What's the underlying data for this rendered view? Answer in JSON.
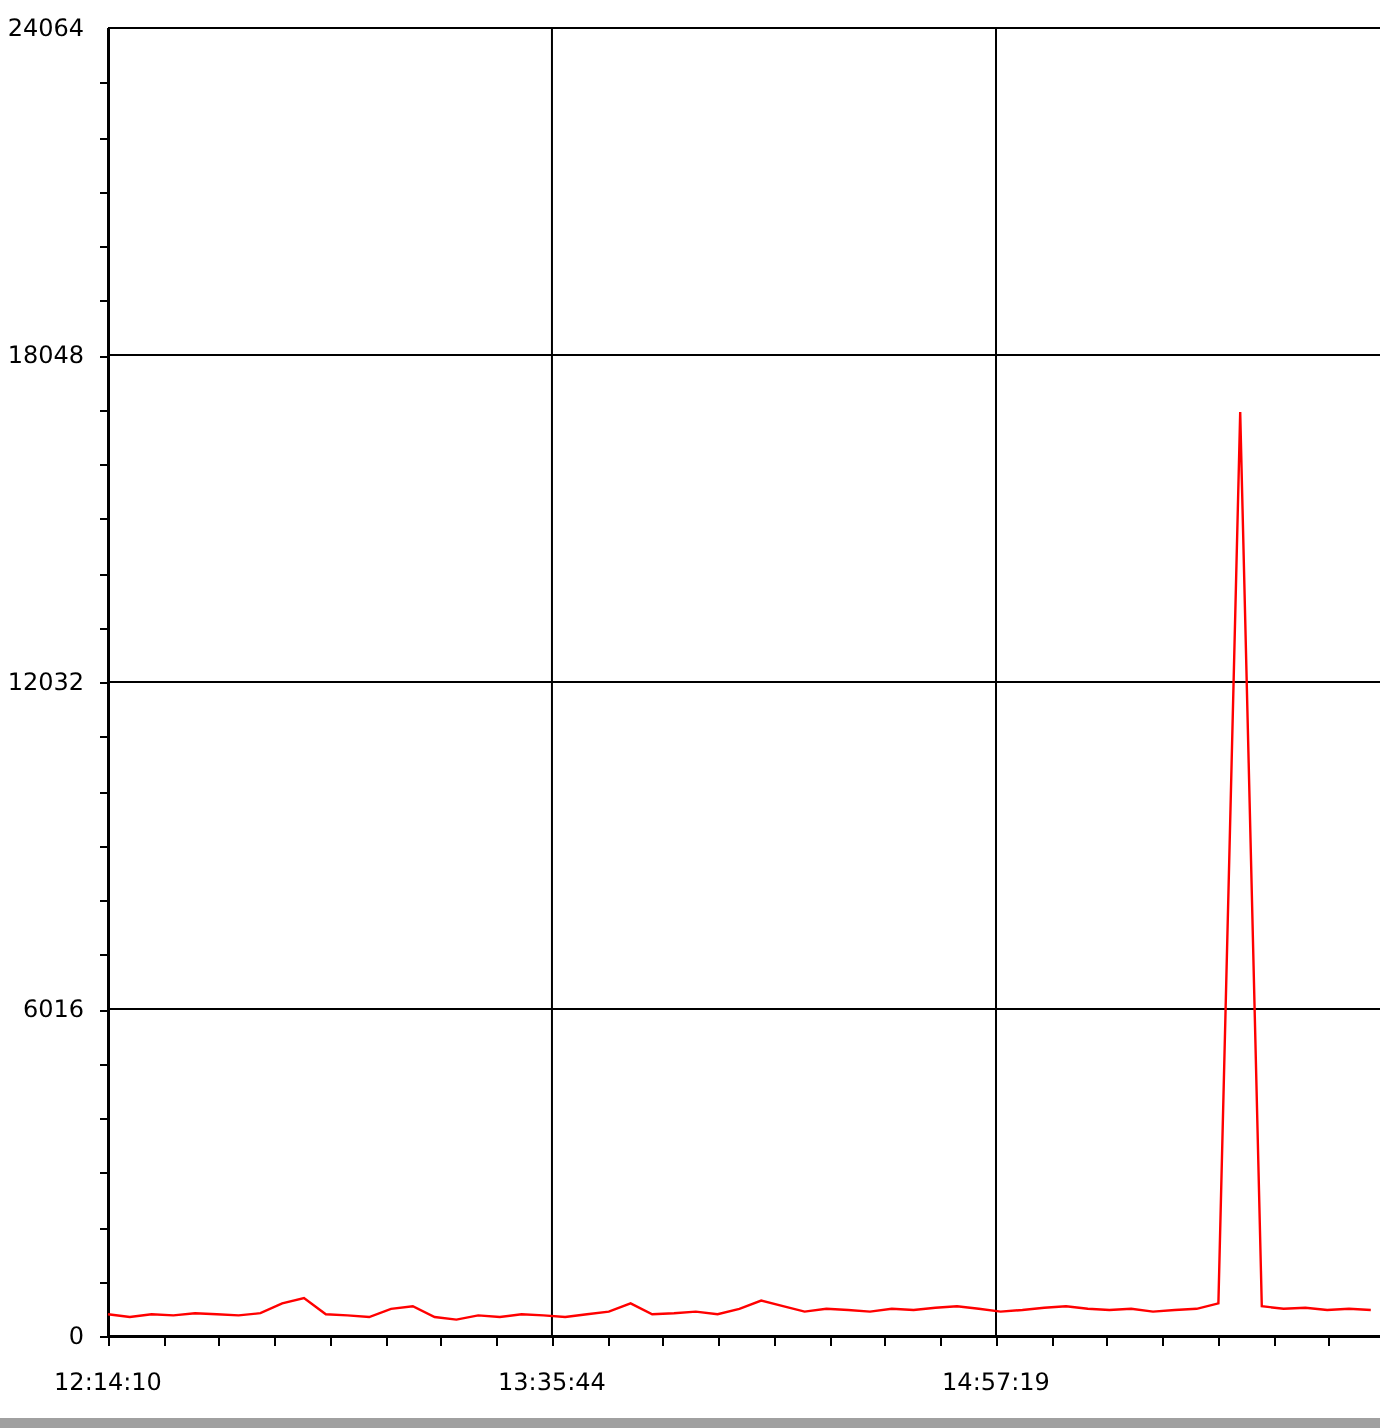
{
  "chart": {
    "chart_data": {
      "type": "line",
      "grid": true,
      "x": [
        44050,
        44290,
        44530,
        44770,
        45010,
        45250,
        45490,
        45730,
        45970,
        46210,
        46450,
        46690,
        46930,
        47170,
        47410,
        47650,
        47890,
        48130,
        48370,
        48610,
        48850,
        49090,
        49330,
        49570,
        49810,
        50050,
        50290,
        50530,
        50770,
        51010,
        51250,
        51490,
        51730,
        51970,
        52210,
        52450,
        52690,
        52930,
        53170,
        53410,
        53650,
        53890,
        54130,
        54370,
        54610,
        54850,
        55090,
        55330,
        55570,
        55810,
        56050,
        56290,
        56530,
        56770,
        57010,
        57250,
        57490,
        57730,
        57970
      ],
      "series": [
        {
          "color": "#ff0000",
          "values": [
            400,
            350,
            400,
            380,
            420,
            400,
            380,
            420,
            600,
            700,
            400,
            380,
            350,
            500,
            550,
            350,
            300,
            380,
            350,
            400,
            380,
            350,
            400,
            450,
            600,
            400,
            420,
            450,
            400,
            500,
            650,
            550,
            450,
            500,
            480,
            450,
            500,
            480,
            520,
            550,
            500,
            450,
            480,
            520,
            550,
            500,
            480,
            500,
            450,
            480,
            500,
            600,
            17000,
            550,
            500,
            520,
            480,
            500,
            480
          ]
        }
      ],
      "xlim": [
        44050,
        58072
      ],
      "ylim": [
        0,
        24064
      ],
      "xticks": [
        {
          "value": 44050,
          "label": "12:14:10"
        },
        {
          "value": 48944,
          "label": "13:35:44"
        },
        {
          "value": 53839,
          "label": "14:57:19"
        }
      ],
      "yticks": [
        0,
        6016,
        12032,
        18048,
        24064
      ]
    }
  }
}
